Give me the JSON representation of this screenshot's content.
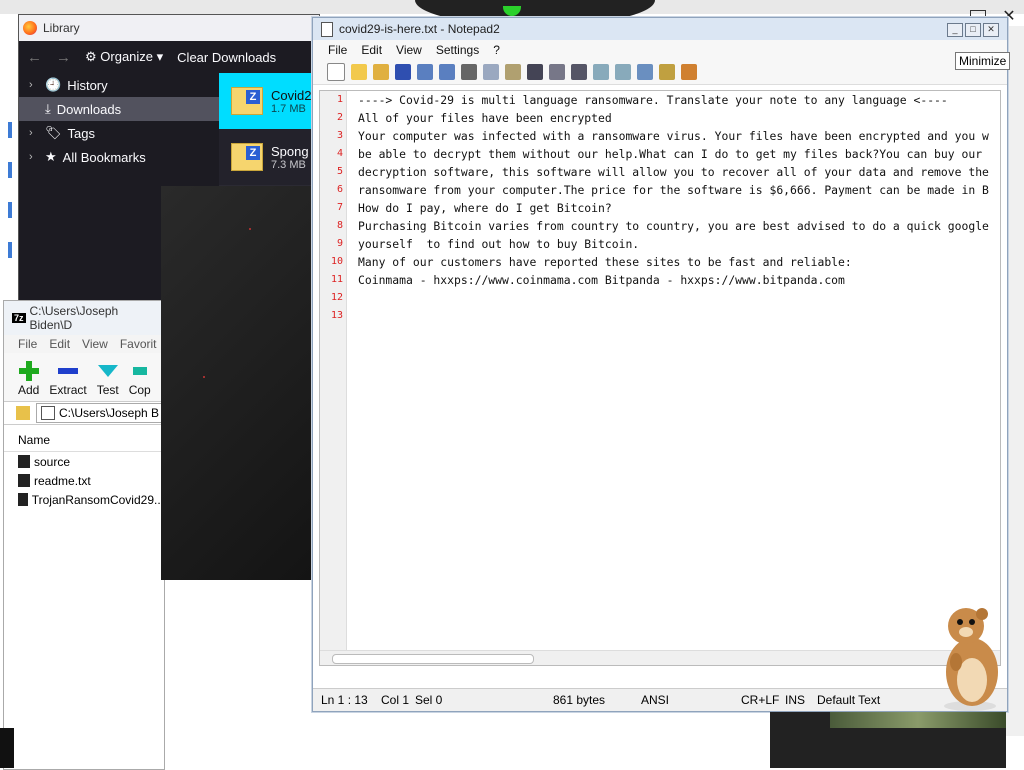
{
  "library": {
    "title": "Library",
    "toolbar": {
      "organize": "Organize",
      "clear": "Clear Downloads"
    },
    "sidebar": [
      {
        "label": "History",
        "selected": false
      },
      {
        "label": "Downloads",
        "selected": true
      },
      {
        "label": "Tags",
        "selected": false
      },
      {
        "label": "All Bookmarks",
        "selected": false
      }
    ],
    "downloads": [
      {
        "name": "Covid2",
        "size": "1.7 MB",
        "selected": true
      },
      {
        "name": "Spong",
        "size": "7.3 MB",
        "selected": false
      }
    ]
  },
  "zip": {
    "title": "C:\\Users\\Joseph Biden\\D",
    "menu": [
      "File",
      "Edit",
      "View",
      "Favorit"
    ],
    "tools": [
      "Add",
      "Extract",
      "Test",
      "Cop"
    ],
    "path": "C:\\Users\\Joseph B",
    "column": "Name",
    "files": [
      "source",
      "readme.txt",
      "TrojanRansomCovid29..."
    ]
  },
  "notepad": {
    "title": "covid29-is-here.txt - Notepad2",
    "menu": [
      "File",
      "Edit",
      "View",
      "Settings",
      "?"
    ],
    "lines": [
      "----> Covid-29 is multi language ransomware. Translate your note to any language <----",
      "All of your files have been encrypted",
      "Your computer was infected with a ransomware virus. Your files have been encrypted and you w",
      "be able to decrypt them without our help.What can I do to get my files back?You can buy our",
      "decryption software, this software will allow you to recover all of your data and remove the",
      "ransomware from your computer.The price for the software is $6,666. Payment can be made in B",
      "How do I pay, where do I get Bitcoin?",
      "Purchasing Bitcoin varies from country to country, you are best advised to do a quick google",
      "yourself  to find out how to buy Bitcoin.",
      "Many of our customers have reported these sites to be fast and reliable:",
      "Coinmama - hxxps://www.coinmama.com Bitpanda - hxxps://www.bitpanda.com",
      "",
      ""
    ],
    "line_numbers": [
      "1",
      "2",
      "3",
      "4",
      "5",
      "6",
      "7",
      "8",
      "9",
      "10",
      "11",
      "12",
      "13"
    ],
    "status": {
      "position": "Ln 1 : 13",
      "col": "Col 1",
      "sel": "Sel 0",
      "size": "861 bytes",
      "encoding": "ANSI",
      "eol": "CR+LF",
      "mode": "INS",
      "scheme": "Default Text"
    }
  },
  "tooltip": "Minimize"
}
